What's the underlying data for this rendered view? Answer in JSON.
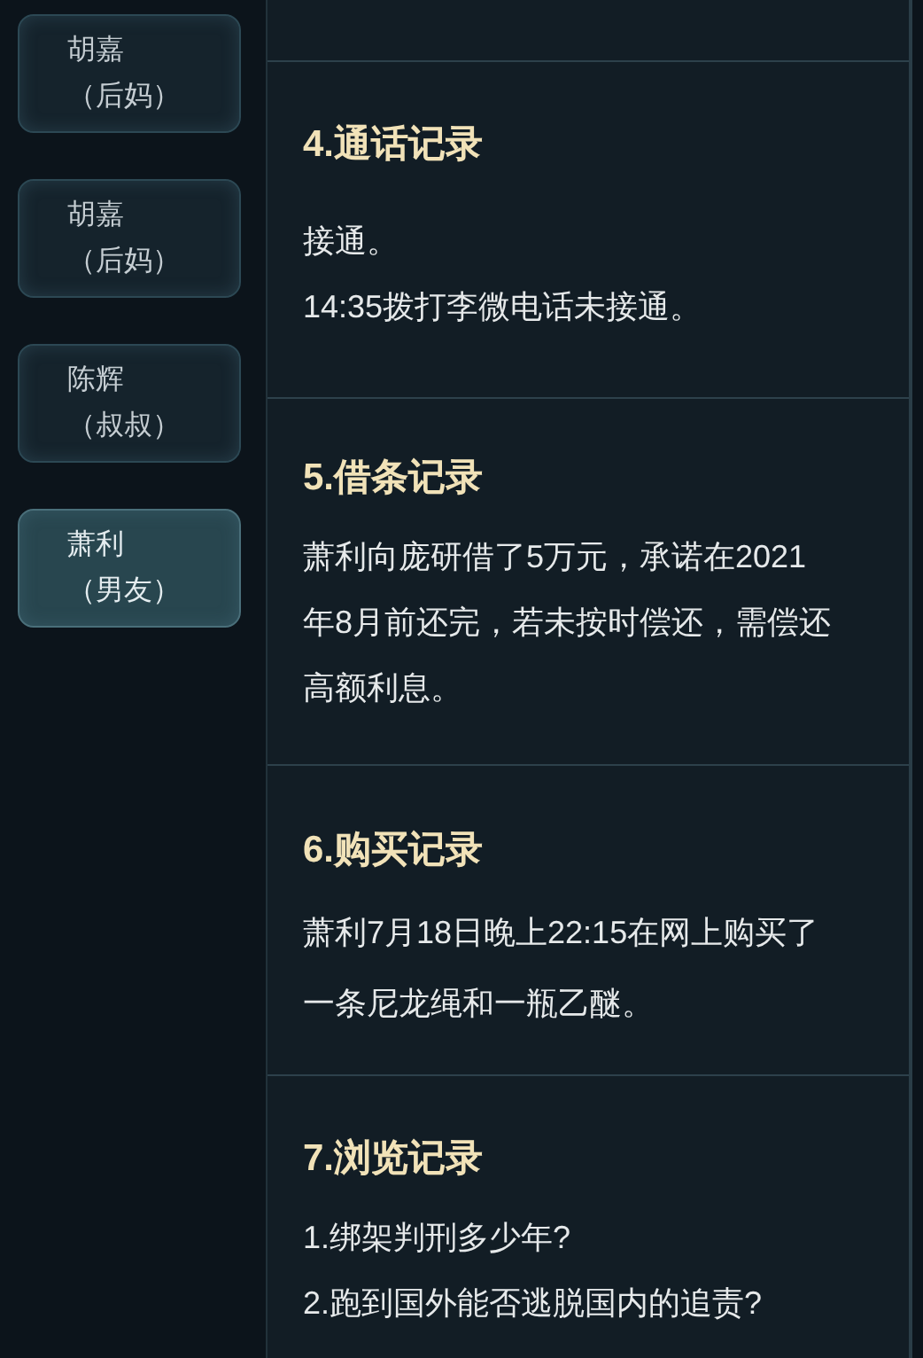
{
  "sidebar": {
    "items": [
      {
        "name": "胡嘉",
        "relation": "（后妈）",
        "selected": false
      },
      {
        "name": "胡嘉",
        "relation": "（后妈）",
        "selected": false
      },
      {
        "name": "陈辉",
        "relation": "（叔叔）",
        "selected": false
      },
      {
        "name": "萧利",
        "relation": "（男友）",
        "selected": true
      }
    ]
  },
  "sections": [
    {
      "title": "4.通话记录",
      "lines": [
        "接通。",
        "14:35拨打李微电话未接通。"
      ]
    },
    {
      "title": "5.借条记录",
      "lines": [
        "萧利向庞研借了5万元，承诺在2021",
        "年8月前还完，若未按时偿还，需偿还",
        "高额利息。"
      ]
    },
    {
      "title": "6.购买记录",
      "lines": [
        "萧利7月18日晚上22:15在网上购买了",
        "一条尼龙绳和一瓶乙醚。"
      ]
    },
    {
      "title": "7.浏览记录",
      "lines": [
        "1.绑架判刑多少年?",
        "2.跑到国外能否逃脱国内的追责?"
      ]
    }
  ]
}
